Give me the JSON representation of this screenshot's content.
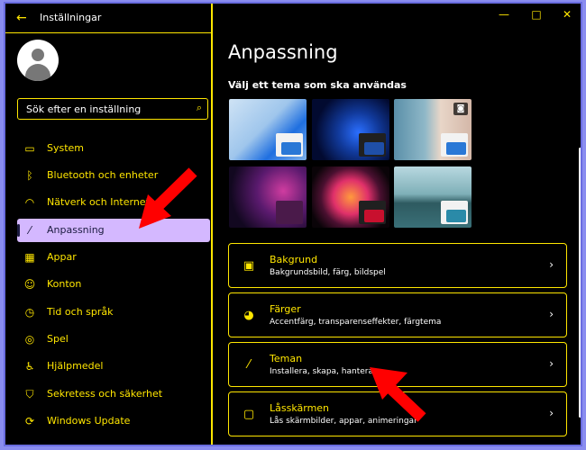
{
  "window": {
    "title": "Inställningar",
    "minimize": "—",
    "maximize": "□",
    "close": "✕"
  },
  "sidebar": {
    "search_placeholder": "Sök efter en inställning",
    "items": [
      {
        "label": "System",
        "icon": "monitor-icon",
        "glyph": "▭"
      },
      {
        "label": "Bluetooth och enheter",
        "icon": "bluetooth-icon",
        "glyph": "ᛒ"
      },
      {
        "label": "Nätverk och Internet",
        "icon": "wifi-icon",
        "glyph": "◠"
      },
      {
        "label": "Anpassning",
        "icon": "brush-icon",
        "glyph": "⁄",
        "active": true
      },
      {
        "label": "Appar",
        "icon": "apps-icon",
        "glyph": "▦"
      },
      {
        "label": "Konton",
        "icon": "person-icon",
        "glyph": "☺"
      },
      {
        "label": "Tid och språk",
        "icon": "clock-language-icon",
        "glyph": "◷"
      },
      {
        "label": "Spel",
        "icon": "gamepad-icon",
        "glyph": "◎"
      },
      {
        "label": "Hjälpmedel",
        "icon": "accessibility-icon",
        "glyph": "♿"
      },
      {
        "label": "Sekretess och säkerhet",
        "icon": "shield-icon",
        "glyph": "⛉"
      },
      {
        "label": "Windows Update",
        "icon": "update-icon",
        "glyph": "⟳"
      }
    ]
  },
  "main": {
    "title": "Anpassning",
    "theme_heading": "Välj ett tema som ska användas",
    "cards": [
      {
        "title": "Bakgrund",
        "subtitle": "Bakgrundsbild, färg, bildspel",
        "icon": "image-icon",
        "glyph": "▣"
      },
      {
        "title": "Färger",
        "subtitle": "Accentfärg, transparenseffekter, färgtema",
        "icon": "palette-icon",
        "glyph": "◕"
      },
      {
        "title": "Teman",
        "subtitle": "Installera, skapa, hantera",
        "icon": "brush-icon",
        "glyph": "⁄"
      },
      {
        "title": "Låsskärmen",
        "subtitle": "Lås skärmbilder, appar, animeringar",
        "icon": "lock-screen-icon",
        "glyph": "▢"
      }
    ]
  },
  "colors": {
    "accent": "#ffe600",
    "active_bg": "#d4b8ff",
    "annotation_arrow": "#ff0000"
  }
}
